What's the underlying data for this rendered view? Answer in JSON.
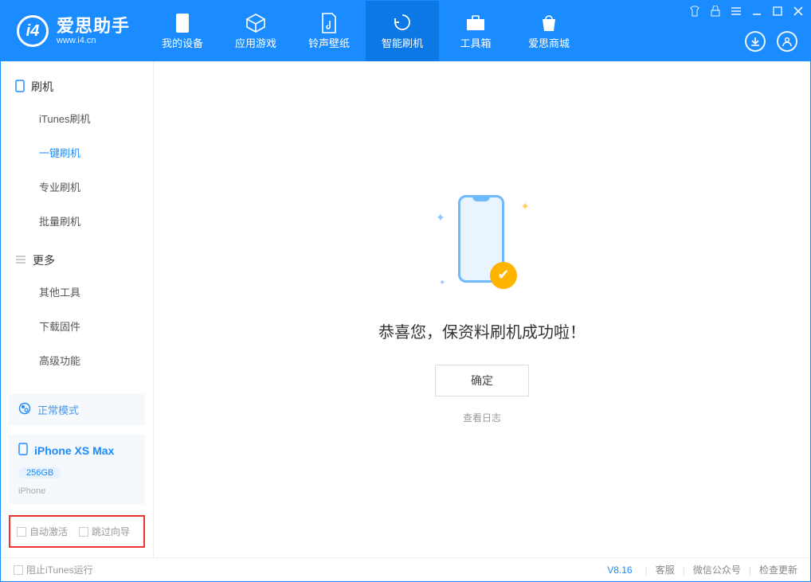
{
  "app": {
    "title": "爱思助手",
    "subtitle": "www.i4.cn"
  },
  "nav": {
    "items": [
      {
        "label": "我的设备"
      },
      {
        "label": "应用游戏"
      },
      {
        "label": "铃声壁纸"
      },
      {
        "label": "智能刷机"
      },
      {
        "label": "工具箱"
      },
      {
        "label": "爱思商城"
      }
    ],
    "active_index": 3
  },
  "sidebar": {
    "section1": {
      "title": "刷机"
    },
    "items1": [
      {
        "label": "iTunes刷机"
      },
      {
        "label": "一键刷机"
      },
      {
        "label": "专业刷机"
      },
      {
        "label": "批量刷机"
      }
    ],
    "active1": 1,
    "section2": {
      "title": "更多"
    },
    "items2": [
      {
        "label": "其他工具"
      },
      {
        "label": "下载固件"
      },
      {
        "label": "高级功能"
      }
    ],
    "mode_panel": {
      "label": "正常模式"
    },
    "device": {
      "name": "iPhone XS Max",
      "capacity": "256GB",
      "type": "iPhone"
    },
    "options": {
      "opt1": "自动激活",
      "opt2": "跳过向导"
    }
  },
  "main": {
    "message": "恭喜您，保资料刷机成功啦！",
    "ok_button": "确定",
    "log_link": "查看日志"
  },
  "footer": {
    "block_itunes": "阻止iTunes运行",
    "version": "V8.16",
    "links": [
      "客服",
      "微信公众号",
      "检查更新"
    ]
  }
}
